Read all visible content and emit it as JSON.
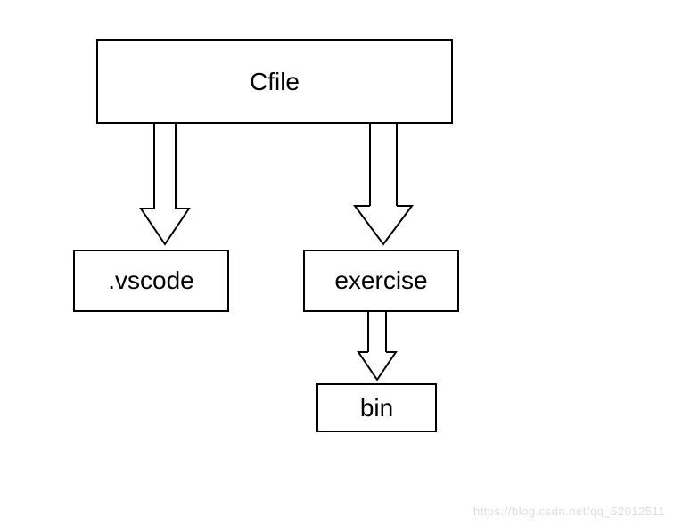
{
  "diagram": {
    "nodes": {
      "root": {
        "label": "Cfile"
      },
      "vscode": {
        "label": ".vscode"
      },
      "exercise": {
        "label": "exercise"
      },
      "bin": {
        "label": "bin"
      }
    },
    "edges": [
      {
        "from": "root",
        "to": "vscode"
      },
      {
        "from": "root",
        "to": "exercise"
      },
      {
        "from": "exercise",
        "to": "bin"
      }
    ]
  },
  "watermark": "https://blog.csdn.net/qq_52012511"
}
